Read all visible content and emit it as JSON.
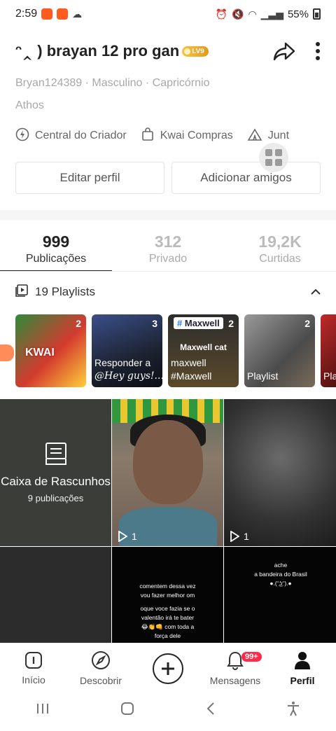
{
  "status_bar": {
    "time": "2:59",
    "battery": "55%"
  },
  "profile": {
    "name": "ᵔ‸ ) brayan 12 pro gan",
    "level_badge": "LV9",
    "meta_line1": "Bryan124389 · Masculino · Capricórnio",
    "meta_line2": "Athos"
  },
  "creator_links": [
    {
      "label": "Central do Criador",
      "icon": "lightning-icon"
    },
    {
      "label": "Kwai Compras",
      "icon": "shopping-bag-icon"
    },
    {
      "label": "Junt",
      "icon": "tent-icon"
    }
  ],
  "buttons": {
    "edit": "Editar perfil",
    "add_friends": "Adicionar amigos"
  },
  "stats": [
    {
      "num": "999",
      "label": "Publicações",
      "active": true
    },
    {
      "num": "312",
      "label": "Privado",
      "active": false
    },
    {
      "num": "19,2K",
      "label": "Curtidas",
      "active": false
    }
  ],
  "playlists": {
    "header": "19 Playlists",
    "items": [
      {
        "count": "2",
        "caption": "",
        "overlay": "KWAI"
      },
      {
        "count": "3",
        "caption1": "Responder a",
        "caption2": "@Hey guys!..."
      },
      {
        "count": "2",
        "tag": "Maxwell",
        "title": "Maxwell cat",
        "caption1": "maxwell",
        "caption2": "#Maxwell"
      },
      {
        "count": "2",
        "caption1": "Playlist"
      },
      {
        "caption1": "Pla"
      }
    ]
  },
  "videos": {
    "draft_title": "Caixa de Rascunhos",
    "draft_sub": "9 publicações",
    "plays_2": "1",
    "plays_3": "1",
    "caption_5": [
      "comentem dessa vez",
      "vou fazer melhor om",
      "",
      "oque voce fazia se o",
      "valentão irá te bater",
      "😂👏👊 com toda a",
      "força dele"
    ],
    "caption_6": [
      "ache",
      "a bandeira do Brasil",
      "●.(ᵔ͜ʖᵔ).●"
    ]
  },
  "bottom_nav": {
    "home": "Início",
    "discover": "Descobrir",
    "messages": "Mensagens",
    "messages_badge": "99+",
    "profile": "Perfil"
  }
}
